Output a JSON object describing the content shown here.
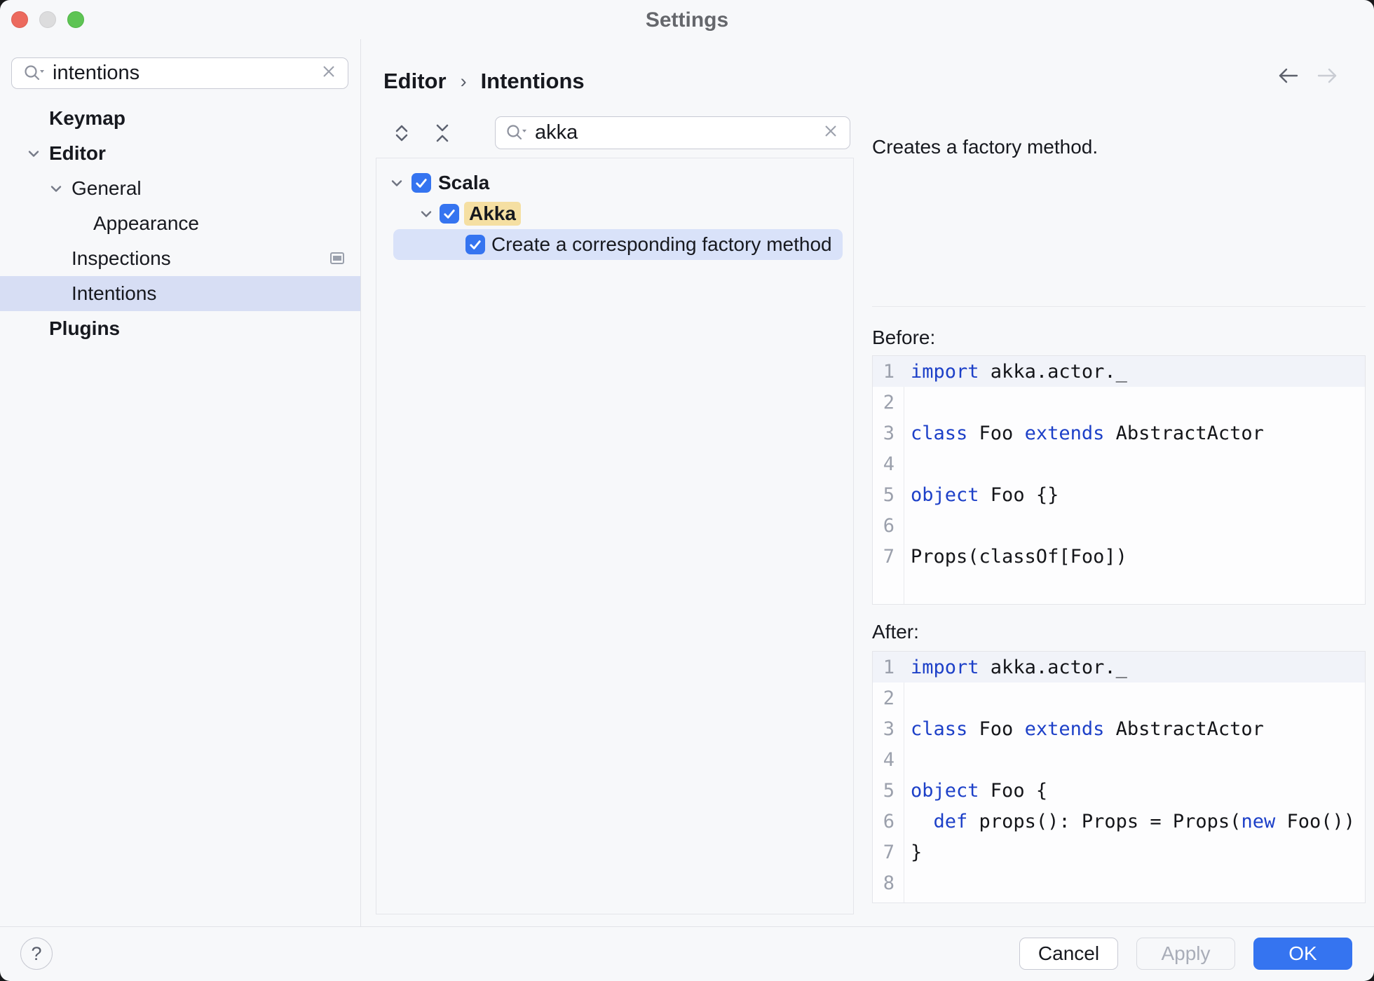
{
  "window": {
    "title": "Settings"
  },
  "sidebar": {
    "search": {
      "value": "intentions"
    },
    "items": [
      {
        "label": "Keymap",
        "bold": true,
        "level": 1,
        "chevron": false,
        "selected": false,
        "trailing_icon": null
      },
      {
        "label": "Editor",
        "bold": true,
        "level": 1,
        "chevron": true,
        "selected": false,
        "trailing_icon": null
      },
      {
        "label": "General",
        "bold": false,
        "level": 2,
        "chevron": true,
        "selected": false,
        "trailing_icon": null
      },
      {
        "label": "Appearance",
        "bold": false,
        "level": 3,
        "chevron": false,
        "selected": false,
        "trailing_icon": null
      },
      {
        "label": "Inspections",
        "bold": false,
        "level": 2,
        "chevron": false,
        "selected": false,
        "trailing_icon": "editor-preview-icon"
      },
      {
        "label": "Intentions",
        "bold": false,
        "level": 2,
        "chevron": false,
        "selected": true,
        "trailing_icon": null
      },
      {
        "label": "Plugins",
        "bold": true,
        "level": 1,
        "chevron": false,
        "selected": false,
        "trailing_icon": null
      }
    ]
  },
  "header": {
    "breadcrumb": [
      {
        "label": "Editor"
      },
      {
        "label": "Intentions"
      }
    ],
    "separator": "›",
    "back_enabled": true,
    "forward_enabled": false
  },
  "center": {
    "search": {
      "value": "akka"
    },
    "tree": [
      {
        "label": "Scala",
        "bold": true,
        "level": 0,
        "chevron": true,
        "checked": true,
        "match": false,
        "selected": false
      },
      {
        "label": "Akka",
        "bold": true,
        "level": 1,
        "chevron": true,
        "checked": true,
        "match": true,
        "selected": false
      },
      {
        "label": "Create a corresponding factory method",
        "bold": false,
        "level": 2,
        "chevron": false,
        "checked": true,
        "match": false,
        "selected": true
      }
    ]
  },
  "detail": {
    "description": "Creates a factory method.",
    "before_label": "Before:",
    "after_label": "After:",
    "before_code": {
      "lines": [
        [
          [
            "k",
            "import"
          ],
          [
            "p",
            " akka.actor._"
          ]
        ],
        [],
        [
          [
            "k",
            "class"
          ],
          [
            "p",
            " Foo "
          ],
          [
            "k",
            "extends"
          ],
          [
            "p",
            " AbstractActor"
          ]
        ],
        [],
        [
          [
            "k",
            "object"
          ],
          [
            "p",
            " Foo {}"
          ]
        ],
        [],
        [
          [
            "p",
            "Props(classOf[Foo])"
          ]
        ]
      ],
      "highlight_line": 1
    },
    "after_code": {
      "lines": [
        [
          [
            "k",
            "import"
          ],
          [
            "p",
            " akka.actor._"
          ]
        ],
        [],
        [
          [
            "k",
            "class"
          ],
          [
            "p",
            " Foo "
          ],
          [
            "k",
            "extends"
          ],
          [
            "p",
            " AbstractActor"
          ]
        ],
        [],
        [
          [
            "k",
            "object"
          ],
          [
            "p",
            " Foo {"
          ]
        ],
        [
          [
            "p",
            "  "
          ],
          [
            "k",
            "def"
          ],
          [
            "p",
            " props(): Props = Props("
          ],
          [
            "k",
            "new"
          ],
          [
            "p",
            " Foo())"
          ]
        ],
        [
          [
            "p",
            "}"
          ]
        ],
        []
      ],
      "highlight_line": 1
    }
  },
  "footer": {
    "help": "?",
    "cancel": "Cancel",
    "apply": "Apply",
    "ok": "OK"
  },
  "colors": {
    "accent": "#3574f0",
    "keyword": "#1d40c8",
    "tree_selection": "#d9e2f9",
    "sidebar_selection": "#d7def4",
    "search_match": "#f5dfa2"
  }
}
